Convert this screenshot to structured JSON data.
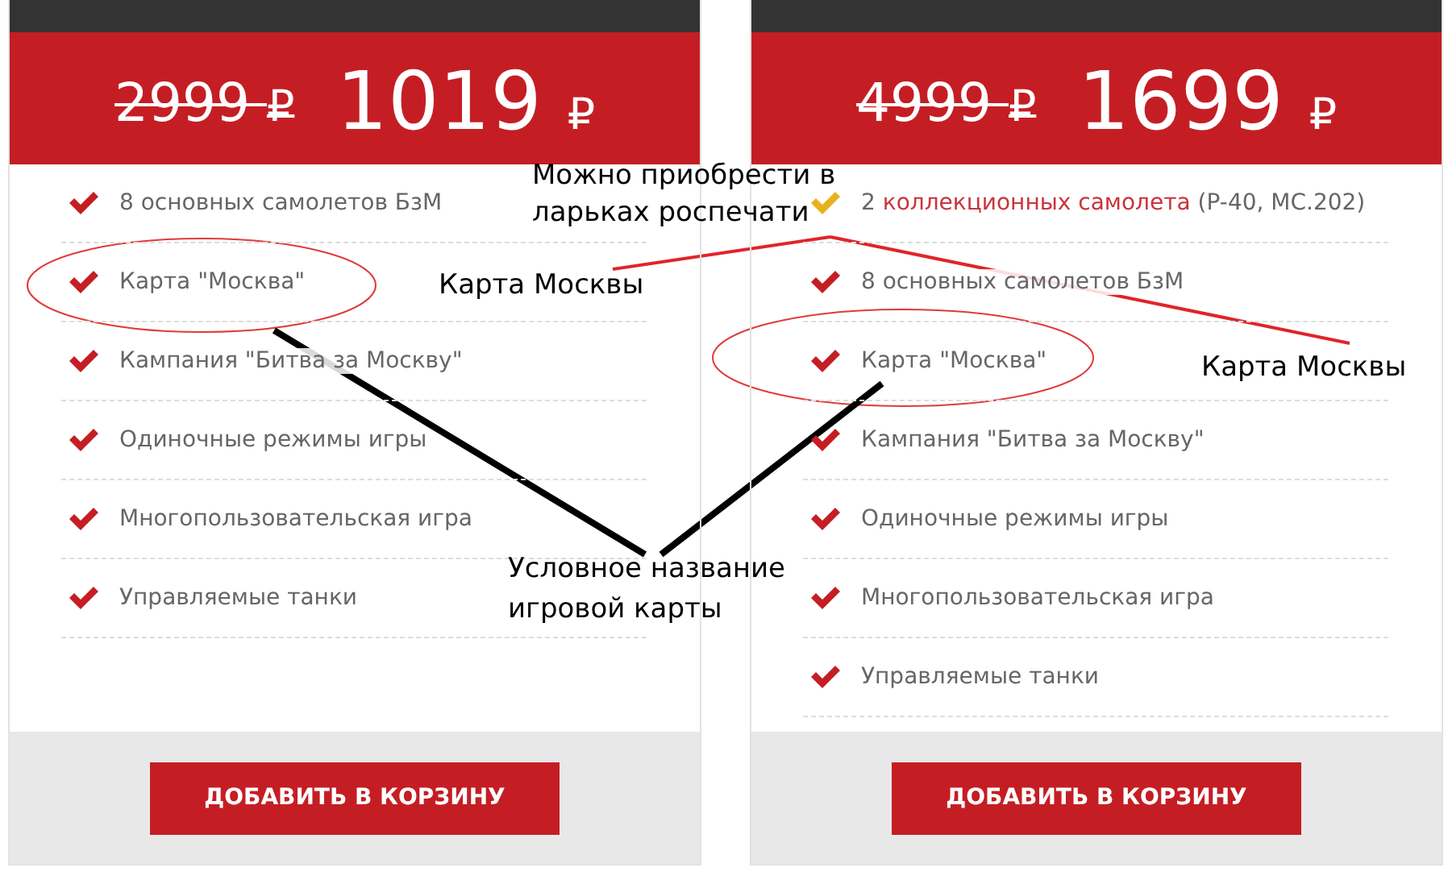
{
  "cards": [
    {
      "old_price": "2999",
      "new_price": "1019",
      "currency": "₽",
      "features": [
        {
          "text": "8 основных самолетов БзМ",
          "color": "#c41e24"
        },
        {
          "text": "Карта \"Москва\"",
          "color": "#c41e24"
        },
        {
          "text": "Кампания \"Битва за Москву\"",
          "color": "#c41e24"
        },
        {
          "text": "Одиночные режимы игры",
          "color": "#c41e24"
        },
        {
          "text": "Многопользовательская игра",
          "color": "#c41e24"
        },
        {
          "text": "Управляемые танки",
          "color": "#c41e24"
        }
      ],
      "button": "ДОБАВИТЬ В КОРЗИНУ"
    },
    {
      "old_price": "4999",
      "new_price": "1699",
      "currency": "₽",
      "features": [
        {
          "parts": [
            {
              "text": "2 ",
              "accent": false
            },
            {
              "text": "коллекционных самолета",
              "accent": true
            },
            {
              "text": " (P-40, MC.202)",
              "accent": false
            }
          ],
          "color": "#e8b21c"
        },
        {
          "text": "8 основных самолетов БзМ",
          "color": "#c41e24"
        },
        {
          "text": "Карта \"Москва\"",
          "color": "#c41e24"
        },
        {
          "text": "Кампания \"Битва за Москву\"",
          "color": "#c41e24"
        },
        {
          "text": "Одиночные режимы игры",
          "color": "#c41e24"
        },
        {
          "text": "Многопользовательская игра",
          "color": "#c41e24"
        },
        {
          "text": "Управляемые танки",
          "color": "#c41e24"
        }
      ],
      "button": "ДОБАВИТЬ В КОРЗИНУ"
    }
  ],
  "annotations": [
    {
      "text": "Можно приобрести в ларьках роспечати"
    },
    {
      "text": "Карта Москвы"
    },
    {
      "text": "Карта Москвы"
    },
    {
      "text": "Условное название игровой карты"
    }
  ]
}
